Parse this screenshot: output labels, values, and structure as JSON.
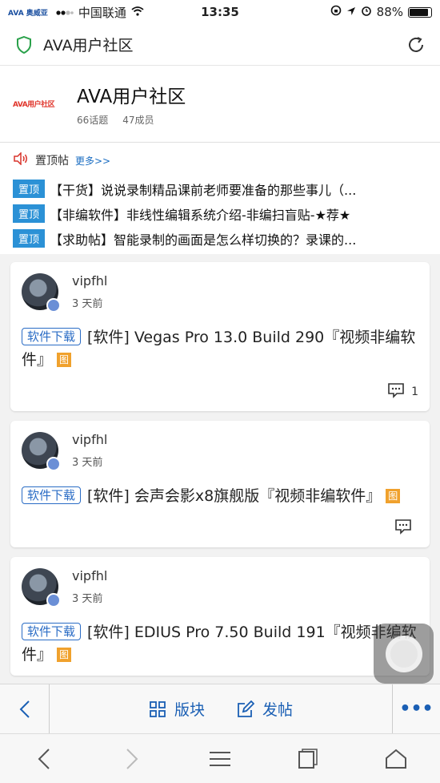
{
  "status": {
    "carrier_logo": "AVA 奥威亚",
    "carrier": "中国联通",
    "time": "13:35",
    "battery": "88%",
    "battery_level": 0.88
  },
  "nav": {
    "title": "AVA用户社区"
  },
  "group": {
    "logo_text": "AVA用户社区",
    "name": "AVA用户社区",
    "topics": "66话题",
    "members": "47成员"
  },
  "pinned": {
    "label": "置顶帖",
    "more": "更多>>",
    "items": [
      {
        "tag": "置顶",
        "text": "【干货】说说录制精品课前老师要准备的那些事儿（..."
      },
      {
        "tag": "置顶",
        "text": "【非编软件】非线性编辑系统介绍-非编扫盲贴-★荐★"
      },
      {
        "tag": "置顶",
        "text": "【求助帖】智能录制的画面是怎么样切换的？录课的..."
      }
    ]
  },
  "posts": [
    {
      "author": "vipfhl",
      "time": "3 天前",
      "tag": "软件下载",
      "title": "[软件] Vegas Pro 13.0 Build 290『视频非编软件』",
      "img_badge": "图",
      "comments": "1"
    },
    {
      "author": "vipfhl",
      "time": "3 天前",
      "tag": "软件下载",
      "title": "[软件] 会声会影x8旗舰版『视频非编软件』",
      "img_badge": "图",
      "comments": ""
    },
    {
      "author": "vipfhl",
      "time": "3 天前",
      "tag": "软件下载",
      "title": "[软件] EDIUS Pro 7.50 Build 191『视频非编软件』",
      "img_badge": "图",
      "comments": ""
    }
  ],
  "toolbar": {
    "board": "版块",
    "post": "发帖",
    "more": "•••"
  },
  "colors": {
    "accent": "#1a5fb4",
    "pin_tag": "#2b91d6",
    "img_badge": "#f0a12d"
  }
}
